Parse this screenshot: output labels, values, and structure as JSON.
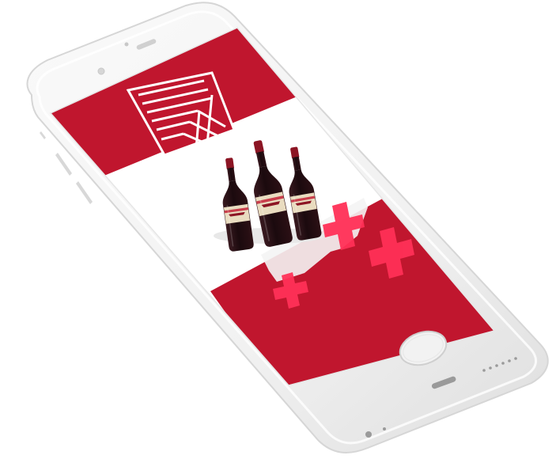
{
  "scene": {
    "subject": "iphone-mockup",
    "device_color": "#f3f3f3",
    "frame_edge_color": "#e2e2e2",
    "screen_background": "#ffffff",
    "brand_red": "#c0162e",
    "accent_pink": "#ff3057",
    "bottle_glass": "#2a1016",
    "bottle_label": "#e9dcc0",
    "bottle_foil": "#8c1524"
  },
  "screen_content": {
    "logo": "striped-square-emblem-icon",
    "product": "wine-bottles-image",
    "pattern": "plus-cross-pattern"
  }
}
